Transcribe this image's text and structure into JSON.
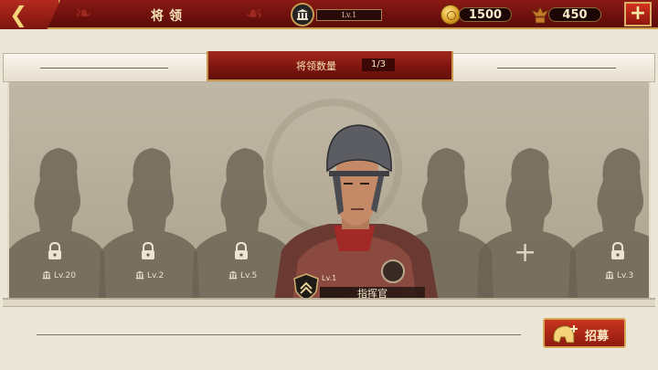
{
  "topbar": {
    "title": "将领",
    "level_label": "Lv.1",
    "gold": "1500",
    "honor": "450",
    "back_icon": "back-chevron-icon",
    "add_icon": "plus-icon"
  },
  "header": {
    "label": "将领数量",
    "count": "1/3"
  },
  "slots": [
    {
      "state": "locked",
      "level": "Lv.20"
    },
    {
      "state": "locked",
      "level": "Lv.2"
    },
    {
      "state": "locked",
      "level": "Lv.5"
    },
    {
      "state": "empty"
    },
    {
      "state": "empty"
    },
    {
      "state": "locked",
      "level": "Lv.3"
    }
  ],
  "commander": {
    "level": "Lv.1",
    "name": "指挥官"
  },
  "footer": {
    "recruit_label": "招募"
  },
  "colors": {
    "accent_red": "#8a1a14",
    "gold_trim": "#c89a4a",
    "panel": "#b8af9b"
  }
}
